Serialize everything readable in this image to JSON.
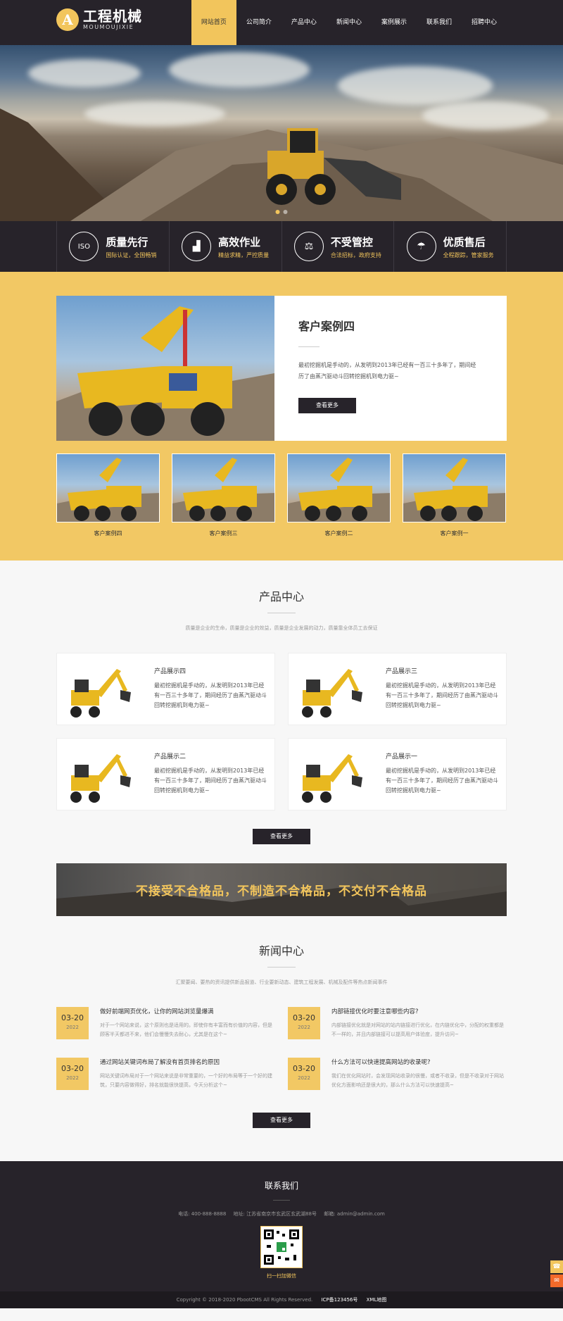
{
  "header": {
    "logo_badge": "A",
    "logo_cn": "工程机械",
    "logo_en": "MOUMOUJIXIE",
    "nav": [
      "网站首页",
      "公司简介",
      "产品中心",
      "新闻中心",
      "案例展示",
      "联系我们",
      "招聘中心"
    ]
  },
  "features": [
    {
      "icon": "ISO",
      "icon_name": "iso-badge-icon",
      "title": "质量先行",
      "sub": "国际认证，全国畅销"
    },
    {
      "icon": "▟",
      "icon_name": "growth-chart-icon",
      "title": "高效作业",
      "sub": "精益求精，严控质量"
    },
    {
      "icon": "⚖",
      "icon_name": "control-icon",
      "title": "不受管控",
      "sub": "合法招标，政府支持"
    },
    {
      "icon": "☂",
      "icon_name": "umbrella-icon",
      "title": "优质售后",
      "sub": "全程跟踪，管家服务"
    }
  ],
  "cases": {
    "main_title": "客户案例四",
    "main_desc": "最初挖掘机是手动的，从发明到2013年已经有一百三十多年了，期间经历了由蒸汽驱动斗回转挖掘机到电力驱~",
    "more": "查看更多",
    "thumbs": [
      "客户案例四",
      "客户案例三",
      "客户案例二",
      "客户案例一"
    ]
  },
  "products": {
    "title": "产品中心",
    "sub": "质量是企业的生命，质量是企业的效益，质量是企业发展的动力，质量靠全体员工去保证",
    "items": [
      {
        "title": "产品展示四",
        "desc": "最初挖掘机是手动的，从发明到2013年已经有一百三十多年了，期间经历了由蒸汽驱动斗回转挖掘机到电力驱~"
      },
      {
        "title": "产品展示三",
        "desc": "最初挖掘机是手动的，从发明到2013年已经有一百三十多年了，期间经历了由蒸汽驱动斗回转挖掘机到电力驱~"
      },
      {
        "title": "产品展示二",
        "desc": "最初挖掘机是手动的，从发明到2013年已经有一百三十多年了，期间经历了由蒸汽驱动斗回转挖掘机到电力驱~"
      },
      {
        "title": "产品展示一",
        "desc": "最初挖掘机是手动的，从发明到2013年已经有一百三十多年了，期间经历了由蒸汽驱动斗回转挖掘机到电力驱~"
      }
    ],
    "more": "查看更多"
  },
  "slogan": "不接受不合格品，不制造不合格品，不交付不合格品",
  "news": {
    "title": "新闻中心",
    "sub": "汇聚要闻、要热的资讯提供新品报道、行业要新动态、建筑工程发展、机械及配件等热点新闻事件",
    "items": [
      {
        "day": "03-20",
        "year": "2022",
        "title": "做好前端网页优化，让你的网站浏览量爆满",
        "desc": "对于一个网站来说，这个原则也是适用的。即使你有丰富而有价值的内容，但是顾客半天都进不来，他们会慢慢失去耐心，尤其是在这个~"
      },
      {
        "day": "03-20",
        "year": "2022",
        "title": "内部链接优化时要注意哪些内容?",
        "desc": "内部链接优化就是对网站的站内链接进行优化，在内链优化中，分配的权重都是不一样的，并且内部链接可以提高用户体验度，提升访问~"
      },
      {
        "day": "03-20",
        "year": "2022",
        "title": "通过网站关键词布局了解没有首页排名的原因",
        "desc": "网站关键词布局对于一个网站来说是非常重要的，一个好的布局等于一个好的建筑，只要内容做得好，排名就能很快提高，今天分析这个~"
      },
      {
        "day": "03-20",
        "year": "2022",
        "title": "什么方法可以快速提高网站的收录呢?",
        "desc": "我们在优化网站时，会发现网站收录的很慢，或者不收录，但是不收录对于网站优化方面影响还是很大的，那么什么方法可以快速提高~"
      }
    ],
    "more": "查看更多"
  },
  "footer": {
    "title": "联系我们",
    "phone": "电话: 400-888-8888",
    "address": "地址: 江苏省南京市玄武区玄武湖88号",
    "email": "邮箱: admin@admin.com",
    "qr_caption": "扫一扫加微信",
    "copyright": "Copyright © 2018-2020 PbootCMS All Rights Reserved.",
    "icp": "ICP备123456号",
    "sitemap": "XML地图"
  },
  "colors": {
    "accent": "#f2c55c",
    "dark": "#27232a"
  }
}
